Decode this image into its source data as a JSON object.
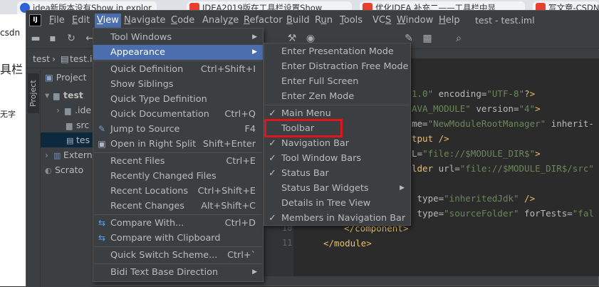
{
  "browser": {
    "tabs": [
      {
        "label": "idea新版本没有Show in explor"
      },
      {
        "label": "IDEA2019版在工具栏设置Show"
      },
      {
        "label": "优化IDEA 补充二——工具栏中显"
      },
      {
        "label": "写文章-CSDN"
      }
    ],
    "left_fragments": [
      "csdn",
      "具栏",
      "无字"
    ]
  },
  "ide": {
    "logo": "IJ",
    "window_title": "test - test.iml",
    "menus": [
      {
        "label": "File",
        "u": "F",
        "rest": "ile"
      },
      {
        "label": "Edit",
        "u": "E",
        "rest": "dit"
      },
      {
        "label": "View",
        "u": "V",
        "rest": "iew"
      },
      {
        "label": "Navigate",
        "u": "N",
        "rest": "avigate"
      },
      {
        "label": "Code",
        "u": "C",
        "rest": "ode"
      },
      {
        "label": "Analyze",
        "pre": "Analy",
        "u": "z",
        "rest": "e"
      },
      {
        "label": "Refactor",
        "u": "R",
        "rest": "efactor"
      },
      {
        "label": "Build",
        "u": "B",
        "rest": "uild"
      },
      {
        "label": "Run",
        "pre": "R",
        "u": "u",
        "rest": "n"
      },
      {
        "label": "Tools",
        "u": "T",
        "rest": "ools"
      },
      {
        "label": "VCS",
        "pre": "VC",
        "u": "S",
        "rest": ""
      },
      {
        "label": "Window",
        "u": "W",
        "rest": "indow"
      },
      {
        "label": "Help",
        "u": "H",
        "rest": "elp"
      }
    ],
    "nav_crumbs": [
      "test",
      "test.i"
    ],
    "project": {
      "stripe_label": "Project",
      "header": "Project",
      "tree": [
        {
          "label": "test",
          "bold": true
        },
        {
          "label": ".ide"
        },
        {
          "label": "src"
        },
        {
          "label": "tes"
        },
        {
          "label": "Extern"
        },
        {
          "label": "Scrato"
        }
      ]
    },
    "gutter_numbers": [
      "10",
      "11"
    ],
    "code_lines": [
      {
        "parts": [
          {
            "t": "1.0\"",
            "c": "str"
          },
          {
            "t": " encoding=",
            "c": "attr"
          },
          {
            "t": "\"UTF-8\"",
            "c": "str"
          },
          {
            "t": "?>",
            "c": "tag"
          }
        ]
      },
      {
        "parts": [
          {
            "t": "AVA_MODULE\"",
            "c": "str"
          },
          {
            "t": " version=",
            "c": "attr"
          },
          {
            "t": "\"4\"",
            "c": "str"
          },
          {
            "t": ">",
            "c": "tag"
          }
        ]
      },
      {
        "parts": [
          {
            "t": "me=",
            "c": "attr"
          },
          {
            "t": "\"NewModuleRootManager\"",
            "c": "str"
          },
          {
            "t": " inherit-",
            "c": "attr"
          }
        ]
      },
      {
        "parts": [
          {
            "t": "tput />",
            "c": "tag"
          }
        ]
      },
      {
        "parts": [
          {
            "t": "L=",
            "c": "attr"
          },
          {
            "t": "\"file://$MODULE_DIR$\"",
            "c": "str"
          },
          {
            "t": ">",
            "c": "tag"
          }
        ]
      },
      {
        "parts": [
          {
            "t": "lder ",
            "c": "tag"
          },
          {
            "t": "url=",
            "c": "attr"
          },
          {
            "t": "\"file://$MODULE_DIR$/src\"",
            "c": "str"
          }
        ]
      },
      {
        "parts": []
      },
      {
        "parts": [
          {
            "t": " type=",
            "c": "attr"
          },
          {
            "t": "\"inheritedJdk\"",
            "c": "str"
          },
          {
            "t": " />",
            "c": "tag"
          }
        ]
      },
      {
        "parts": [
          {
            "t": " type=",
            "c": "attr"
          },
          {
            "t": "\"sourceFolder\"",
            "c": "str"
          },
          {
            "t": " forTests=",
            "c": "attr"
          },
          {
            "t": "\"fal",
            "c": "str"
          }
        ]
      },
      {
        "parts": [
          {
            "t": "  </component>",
            "c": "tag"
          }
        ]
      },
      {
        "parts": [
          {
            "t": "</module>",
            "c": "tag"
          }
        ]
      }
    ]
  },
  "view_menu": {
    "items": [
      {
        "label": "Tool Windows",
        "shortcut": "",
        "submenu": true
      },
      {
        "label": "Appearance",
        "shortcut": "",
        "submenu": true,
        "highlighted": true
      },
      {
        "sep": true
      },
      {
        "label": "Quick Definition",
        "shortcut": "Ctrl+Shift+I"
      },
      {
        "label": "Show Siblings",
        "shortcut": ""
      },
      {
        "label": "Quick Type Definition",
        "shortcut": ""
      },
      {
        "label": "Quick Documentation",
        "shortcut": "Ctrl+Q"
      },
      {
        "label": "Jump to Source",
        "shortcut": "F4",
        "icon": "pencil-icon"
      },
      {
        "label": "Open in Right Split",
        "shortcut": "Shift+Enter",
        "icon": "split-icon"
      },
      {
        "sep": true
      },
      {
        "label": "Recent Files",
        "shortcut": "Ctrl+E"
      },
      {
        "label": "Recently Changed Files",
        "shortcut": ""
      },
      {
        "label": "Recent Locations",
        "shortcut": "Ctrl+Shift+E"
      },
      {
        "label": "Recent Changes",
        "shortcut": "Alt+Shift+C"
      },
      {
        "sep": true
      },
      {
        "label": "Compare With...",
        "shortcut": "Ctrl+D",
        "icon": "compare-icon"
      },
      {
        "label": "Compare with Clipboard",
        "shortcut": "",
        "icon": "compare-clipboard-icon"
      },
      {
        "sep": true
      },
      {
        "label": "Quick Switch Scheme...",
        "shortcut": "Ctrl+`"
      },
      {
        "sep": true
      },
      {
        "label": "Bidi Text Base Direction",
        "shortcut": "",
        "submenu": true
      }
    ]
  },
  "appearance_menu": {
    "items": [
      {
        "label": "Enter Presentation Mode"
      },
      {
        "label": "Enter Distraction Free Mode"
      },
      {
        "label": "Enter Full Screen"
      },
      {
        "label": "Enter Zen Mode"
      },
      {
        "sep": true
      },
      {
        "label": "Main Menu",
        "checked": true
      },
      {
        "label": "Toolbar",
        "checked": false,
        "boxed": true
      },
      {
        "label": "Navigation Bar",
        "checked": true
      },
      {
        "label": "Tool Window Bars",
        "checked": true
      },
      {
        "label": "Status Bar",
        "checked": true
      },
      {
        "label": "Status Bar Widgets",
        "submenu": true
      },
      {
        "label": "Details in Tree View"
      },
      {
        "label": "Members in Navigation Bar",
        "checked": true
      }
    ]
  },
  "colors": {
    "highlight": "#4b6eaf",
    "annotation_box": "#e0151b"
  }
}
